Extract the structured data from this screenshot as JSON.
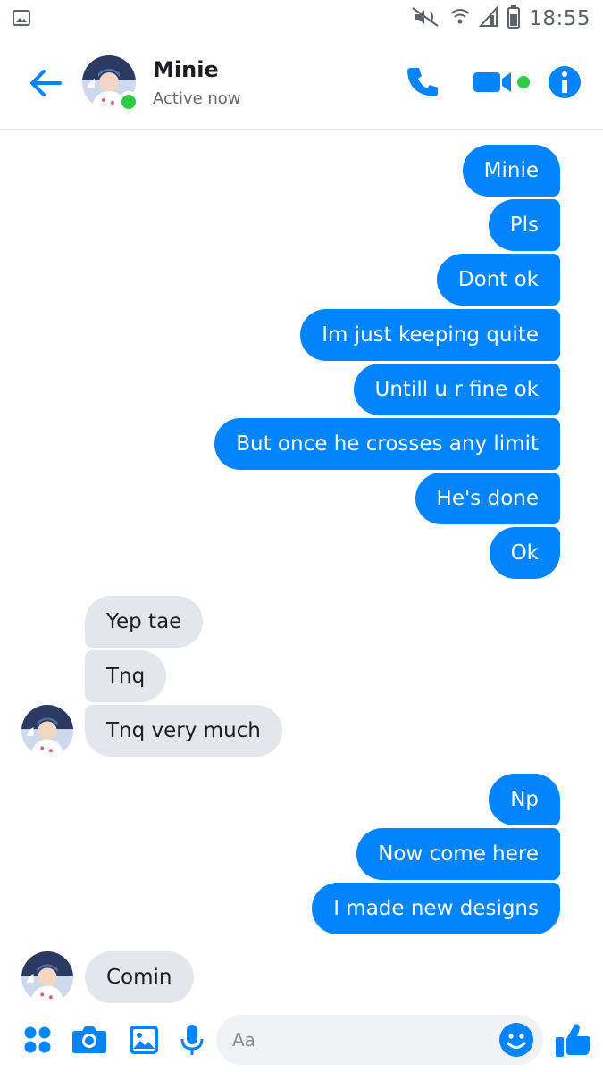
{
  "status_bar": {
    "time": "18:55",
    "icons": [
      "gallery-notification-icon",
      "mute-icon",
      "wifi-icon",
      "signal-icon",
      "battery-icon"
    ]
  },
  "header": {
    "contact_name": "Minie",
    "contact_status": "Active now",
    "icons": [
      "back-arrow-icon",
      "phone-icon",
      "video-camera-icon",
      "info-icon"
    ]
  },
  "colors": {
    "accent": "#0084ff",
    "outgoing_bubble": "#0084ff",
    "incoming_bubble": "#e4e6eb",
    "online_green": "#2ecc40"
  },
  "messages": {
    "group1_outgoing": [
      "Minie",
      "Pls",
      "Dont ok",
      "Im just keeping quite",
      "Untill u r fine ok",
      "But once he crosses any limit",
      "He's done",
      "Ok"
    ],
    "group2_incoming": [
      "Yep tae",
      "Tnq",
      "Tnq very much"
    ],
    "group3_outgoing": [
      "Np",
      "Now come here",
      "I made new designs"
    ],
    "group4_incoming": [
      "Comin"
    ]
  },
  "composer": {
    "placeholder": "Aa",
    "icons": [
      "apps-grid-icon",
      "camera-icon",
      "image-icon",
      "microphone-icon",
      "emoji-icon",
      "thumbs-up-icon"
    ]
  }
}
